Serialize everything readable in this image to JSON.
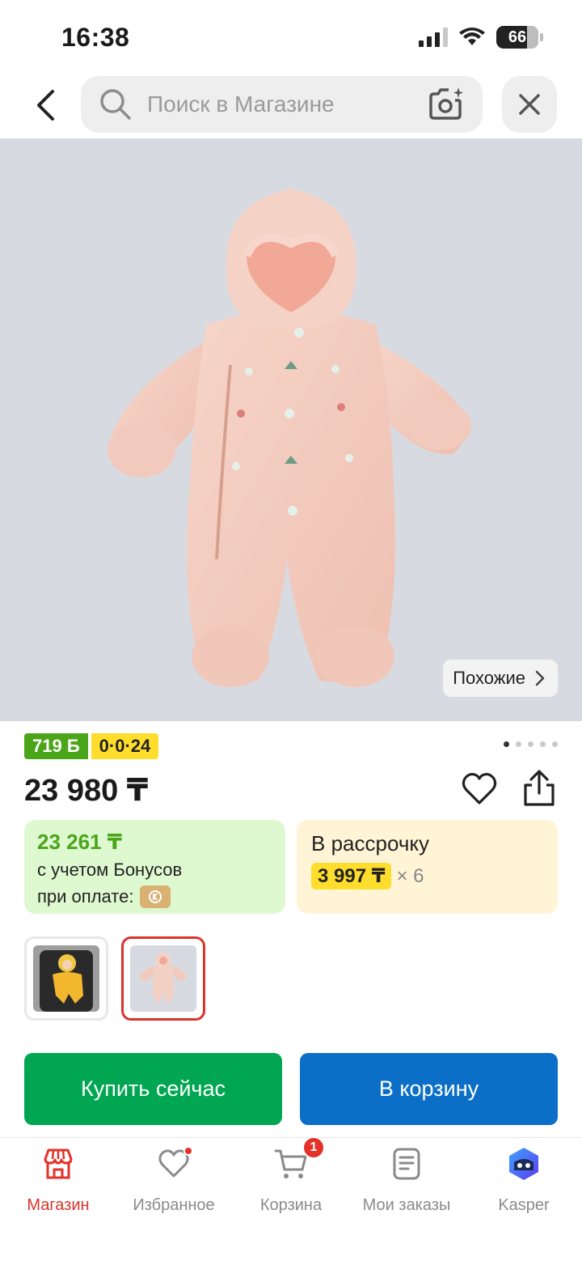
{
  "status_bar": {
    "time": "16:38",
    "battery": "66"
  },
  "header": {
    "search_placeholder": "Поиск в Магазине"
  },
  "product": {
    "similar_label": "Похожие",
    "bonus_badge": "719 Б",
    "installment_badge": "0·0·24",
    "price": "23 980 ₸",
    "gallery_count": 5,
    "gallery_index": 0
  },
  "bonus_card": {
    "price": "23 261 ₸",
    "line1": "с учетом Бонусов",
    "line2": "при оплате:"
  },
  "installment_card": {
    "title": "В рассрочку",
    "amount": "3 997 ₸",
    "multiplier": "× 6"
  },
  "actions": {
    "buy_now": "Купить сейчас",
    "add_to_cart": "В корзину"
  },
  "tabbar": {
    "items": [
      {
        "label": "Магазин",
        "icon": "shop-icon",
        "active": true
      },
      {
        "label": "Избранное",
        "icon": "heart-icon"
      },
      {
        "label": "Корзина",
        "icon": "cart-icon",
        "badge": "1"
      },
      {
        "label": "Мои заказы",
        "icon": "orders-icon"
      },
      {
        "label": "Kasper",
        "icon": "kasper-icon"
      }
    ]
  },
  "colors": {
    "accent_red": "#d9342b",
    "buy_green": "#00a651",
    "cart_blue": "#0b6fc7",
    "bonus_green": "#4aa518",
    "install_yellow": "#ffdd2d"
  }
}
